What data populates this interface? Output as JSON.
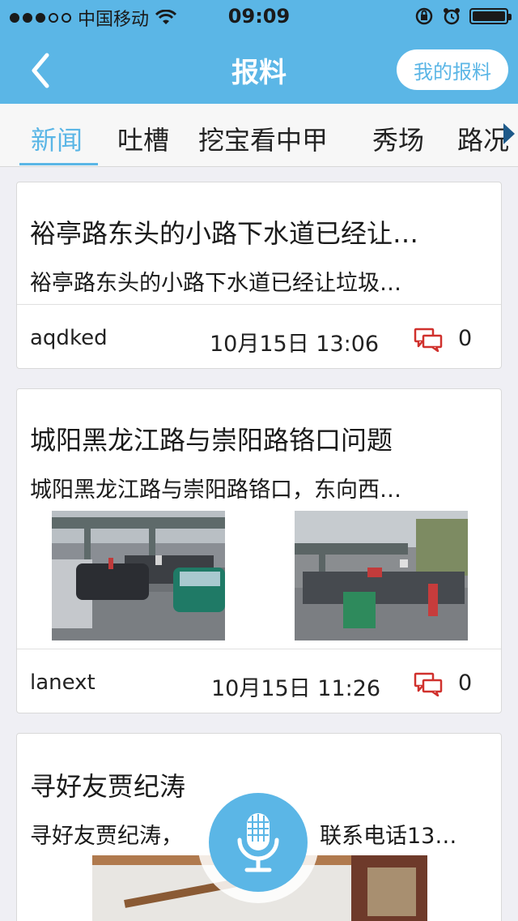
{
  "status_bar": {
    "carrier": "中国移动",
    "time": "09:09"
  },
  "nav": {
    "title": "报料",
    "my_button": "我的报料"
  },
  "tabs": [
    {
      "label": "新闻",
      "active": true
    },
    {
      "label": "吐槽",
      "active": false
    },
    {
      "label": "挖宝看中甲",
      "active": false
    },
    {
      "label": "秀场",
      "active": false
    },
    {
      "label": "路况",
      "active": false
    }
  ],
  "posts": [
    {
      "title": "裕亭路东头的小路下水道已经让…",
      "summary": "裕亭路东头的小路下水道已经让垃圾…",
      "author": "aqdked",
      "date": "10月15日 13:06",
      "comments": "0"
    },
    {
      "title": "城阳黑龙江路与崇阳路铬口问题",
      "summary": "城阳黑龙江路与崇阳路铬口，东向西…",
      "author": "lanext",
      "date": "10月15日 11:26",
      "comments": "0"
    },
    {
      "title": "寻好友贾纪涛",
      "summary_left": "寻好友贾纪涛，",
      "summary_right": "联系电话13…"
    }
  ],
  "colors": {
    "accent": "#5bb6e6",
    "comment_icon": "#d0312d"
  },
  "icons": {
    "back": "chevron-left-icon",
    "comment": "comment-bubbles-icon",
    "mic": "microphone-icon"
  }
}
